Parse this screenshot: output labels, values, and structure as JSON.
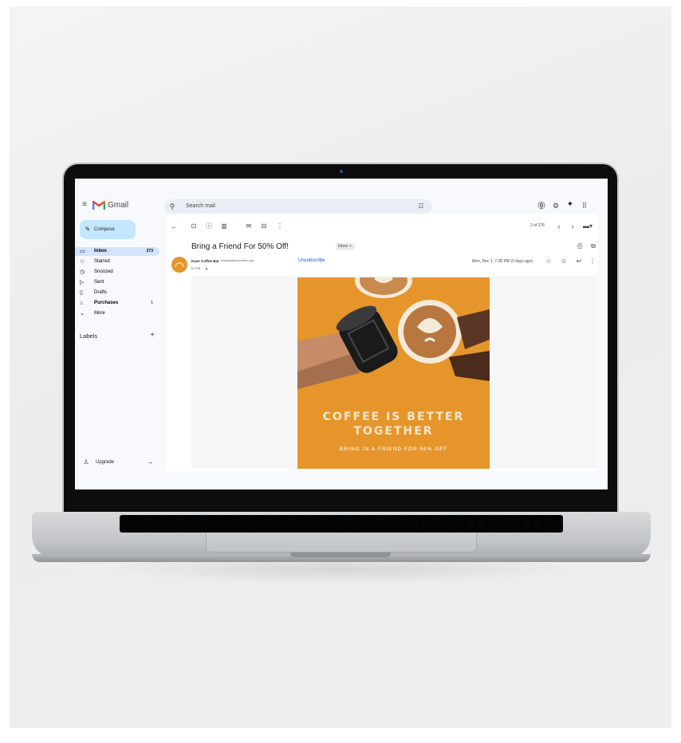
{
  "app": {
    "name": "Gmail",
    "brand_color": "#ea4335",
    "accent": "#0b57d0"
  },
  "search": {
    "placeholder": "Search mail"
  },
  "header_icons": [
    "help-icon",
    "settings-icon",
    "gemini-icon",
    "apps-grid-icon"
  ],
  "sidebar": {
    "compose_label": "Compose",
    "items": [
      {
        "label": "Inbox",
        "count": "273",
        "icon": "inbox-icon",
        "active": true
      },
      {
        "label": "Starred",
        "count": "",
        "icon": "star-icon"
      },
      {
        "label": "Snoozed",
        "count": "",
        "icon": "clock-icon"
      },
      {
        "label": "Sent",
        "count": "",
        "icon": "send-icon"
      },
      {
        "label": "Drafts",
        "count": "",
        "icon": "draft-icon"
      },
      {
        "label": "Purchases",
        "count": "1",
        "icon": "shopping-bag-icon",
        "bold": true
      },
      {
        "label": "More",
        "count": "",
        "icon": "chevron-down-icon"
      }
    ],
    "labels_heading": "Labels",
    "upgrade_label": "Upgrade"
  },
  "toolbar": {
    "pagination": "2 of 276",
    "icons": [
      "back-arrow-icon",
      "archive-icon",
      "report-spam-icon",
      "delete-icon",
      "mark-unread-icon",
      "move-to-icon",
      "more-vert-icon"
    ]
  },
  "message": {
    "subject": "Bring a Friend For 50% Off!",
    "label_chip": "Inbox",
    "label_chip_close": "×",
    "sender_name": "Kave Coffee Bar",
    "sender_email": "<noreply@kavecoffee.org>",
    "to_line": "to me",
    "unsubscribe": "Unsubscribe",
    "date": "Mon, Dec 1, 7:28 PM (3 days ago)"
  },
  "promo": {
    "headline_line1": "COFFEE IS BETTER",
    "headline_line2": "TOGETHER",
    "subline": "BRING IN A FRIEND FOR 50% OFF",
    "background": "#e6952a"
  }
}
